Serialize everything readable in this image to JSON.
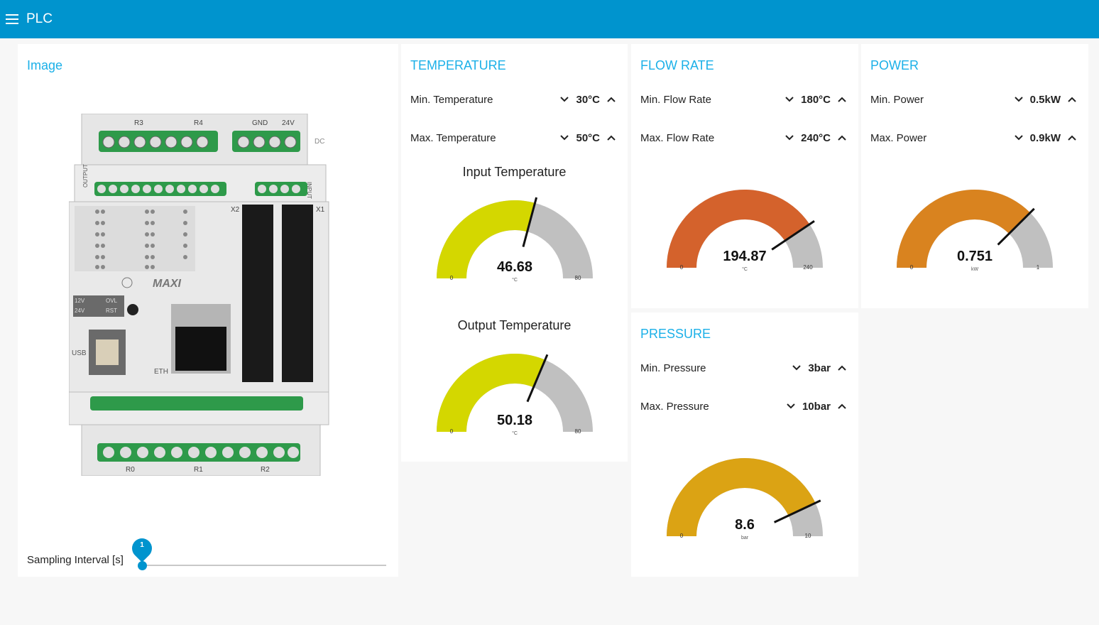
{
  "app": {
    "title": "PLC",
    "menu_icon": "hamburger-icon"
  },
  "image_card": {
    "title": "Image",
    "slider": {
      "label": "Sampling Interval [s]",
      "value": "1",
      "fraction": 0.0
    }
  },
  "temperature": {
    "title": "TEMPERATURE",
    "min": {
      "label": "Min. Temperature",
      "value": "30°C"
    },
    "max": {
      "label": "Max. Temperature",
      "value": "50°C"
    },
    "gauges": [
      {
        "title": "Input Temperature",
        "value": "46.68",
        "num": 46.68,
        "min": 0,
        "max": 80,
        "min_label": "0",
        "max_label": "80",
        "unit": "°C",
        "color": "#d4d700"
      },
      {
        "title": "Output Temperature",
        "value": "50.18",
        "num": 50.18,
        "min": 0,
        "max": 80,
        "min_label": "0",
        "max_label": "80",
        "unit": "°C",
        "color": "#d4d700"
      }
    ]
  },
  "flow": {
    "title": "FLOW RATE",
    "min": {
      "label": "Min. Flow Rate",
      "value": "180°C"
    },
    "max": {
      "label": "Max. Flow Rate",
      "value": "240°C"
    },
    "gauge": {
      "value": "194.87",
      "num": 194.87,
      "min": 0,
      "max": 240,
      "min_label": "0",
      "max_label": "240",
      "unit": "°C",
      "color": "#d4622c"
    }
  },
  "power": {
    "title": "POWER",
    "min": {
      "label": "Min. Power",
      "value": "0.5kW"
    },
    "max": {
      "label": "Max. Power",
      "value": "0.9kW"
    },
    "gauge": {
      "value": "0.751",
      "num": 0.751,
      "min": 0,
      "max": 1,
      "min_label": "0",
      "max_label": "1",
      "unit": "kW",
      "color": "#d9831f"
    }
  },
  "pressure": {
    "title": "PRESSURE",
    "min": {
      "label": "Min. Pressure",
      "value": "3bar"
    },
    "max": {
      "label": "Max. Pressure",
      "value": "10bar"
    },
    "gauge": {
      "value": "8.6",
      "num": 8.6,
      "min": 0,
      "max": 10,
      "min_label": "0",
      "max_label": "10",
      "unit": "bar",
      "color": "#dba314"
    }
  },
  "plc_device": {
    "brand": "MAXI",
    "labels": [
      "R3",
      "R4",
      "GND",
      "24V",
      "DC",
      "OUTPUT",
      "INPUT",
      "X2",
      "X1",
      "USB",
      "ETH",
      "R0",
      "R1",
      "R2",
      "12V",
      "24V",
      "OVL",
      "RST"
    ]
  }
}
